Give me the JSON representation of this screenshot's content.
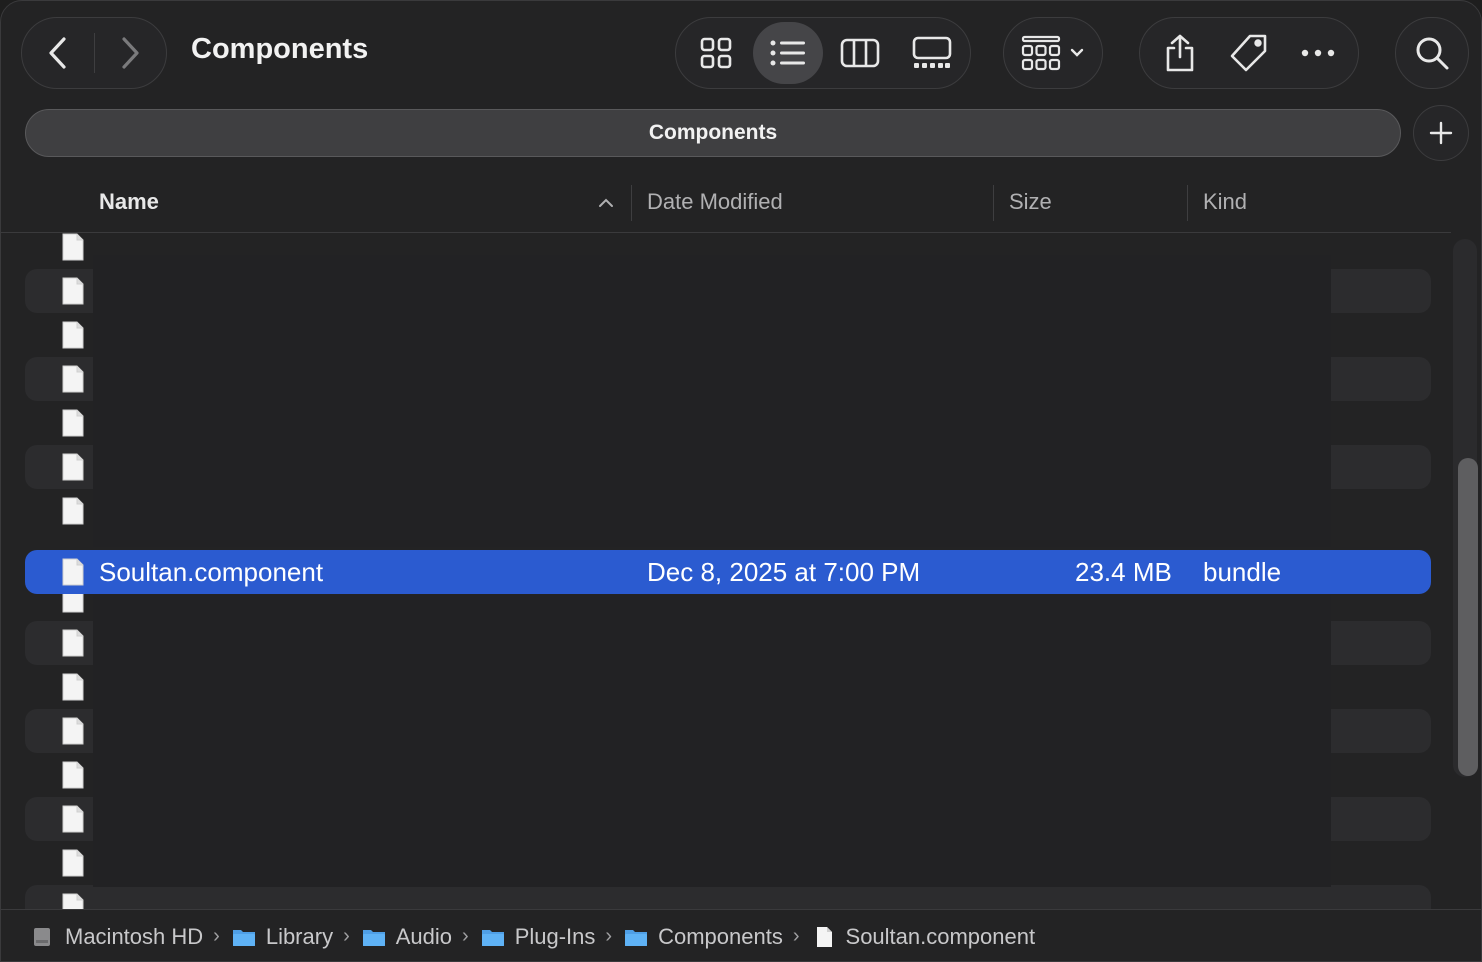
{
  "window": {
    "title": "Components"
  },
  "tab": {
    "label": "Components"
  },
  "toolbar": {
    "nav": [
      "back-icon",
      "forward-icon"
    ],
    "views": [
      "icon-view-icon",
      "list-view-icon",
      "column-view-icon",
      "gallery-view-icon"
    ],
    "active_view": "list",
    "actions": [
      "share-icon",
      "tag-icon",
      "more-icon"
    ]
  },
  "columns": {
    "name": "Name",
    "date": "Date Modified",
    "size": "Size",
    "kind": "Kind"
  },
  "selected_file": {
    "name": "Soultan.component",
    "date": "Dec 8, 2025 at 7:00 PM",
    "size": "23.4 MB",
    "kind": "bundle"
  },
  "pathbar": {
    "items": [
      "Macintosh HD",
      "Library",
      "Audio",
      "Plug-Ins",
      "Components",
      "Soultan.component"
    ],
    "separator": "›"
  },
  "colors": {
    "selection": "#2b5bd0",
    "folder": "#5fb2f5",
    "background": "#232324"
  }
}
